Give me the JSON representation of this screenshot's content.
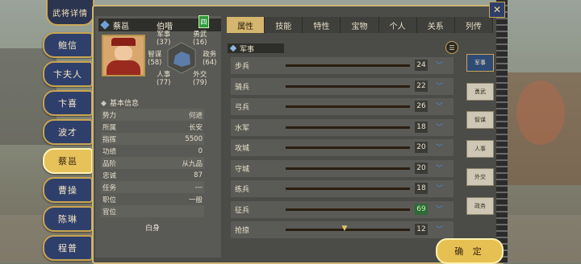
{
  "header": {
    "title": "武将详情"
  },
  "sidebar": {
    "items": [
      {
        "label": "鲍信"
      },
      {
        "label": "卞夫人"
      },
      {
        "label": "卞喜"
      },
      {
        "label": "波才"
      },
      {
        "label": "蔡邕",
        "active": true
      },
      {
        "label": "曹操"
      },
      {
        "label": "陈琳"
      },
      {
        "label": "程普"
      }
    ]
  },
  "general": {
    "name": "蔡邕",
    "courtesy": "伯喈",
    "badge": "四",
    "stats": {
      "military": {
        "label": "军事",
        "value": "(37)"
      },
      "valor": {
        "label": "勇武",
        "value": "(16)"
      },
      "strategy": {
        "label": "智谋",
        "value": "(58)"
      },
      "politics": {
        "label": "政务",
        "value": "(64)"
      },
      "personnel": {
        "label": "人事",
        "value": "(77)"
      },
      "diplomacy": {
        "label": "外交",
        "value": "(79)"
      }
    },
    "basic_header": "基本信息",
    "basic": [
      {
        "label": "势力",
        "value": "何进"
      },
      {
        "label": "所属",
        "value": "长安"
      },
      {
        "label": "指挥",
        "value": "5500"
      },
      {
        "label": "功绩",
        "value": "0"
      },
      {
        "label": "品阶",
        "value": "从九品"
      },
      {
        "label": "忠诚",
        "value": "87"
      },
      {
        "label": "任务",
        "value": "---"
      },
      {
        "label": "职位",
        "value": "一般"
      },
      {
        "label": "官位",
        "value": ""
      }
    ],
    "status": "白身"
  },
  "tabs": [
    "属性",
    "技能",
    "特性",
    "宝物",
    "个人",
    "关系",
    "列传"
  ],
  "section": {
    "title": "军事"
  },
  "skills": [
    {
      "label": "步兵",
      "value": "24",
      "highlight": false
    },
    {
      "label": "骑兵",
      "value": "22",
      "highlight": false
    },
    {
      "label": "弓兵",
      "value": "26",
      "highlight": false
    },
    {
      "label": "水军",
      "value": "18",
      "highlight": false
    },
    {
      "label": "攻城",
      "value": "20",
      "highlight": false
    },
    {
      "label": "守城",
      "value": "20",
      "highlight": false
    },
    {
      "label": "练兵",
      "value": "18",
      "highlight": false
    },
    {
      "label": "征兵",
      "value": "69",
      "highlight": true
    },
    {
      "label": "抢掠",
      "value": "12",
      "highlight": false
    }
  ],
  "right_tabs": [
    "军事",
    "勇武",
    "智谋",
    "人事",
    "外交",
    "政务"
  ],
  "buttons": {
    "confirm": "确 定",
    "close": "✕"
  },
  "icons": {
    "list": "list-icon",
    "chevron": "chevron-down-icon",
    "scroll": "scroll-down-icon"
  }
}
